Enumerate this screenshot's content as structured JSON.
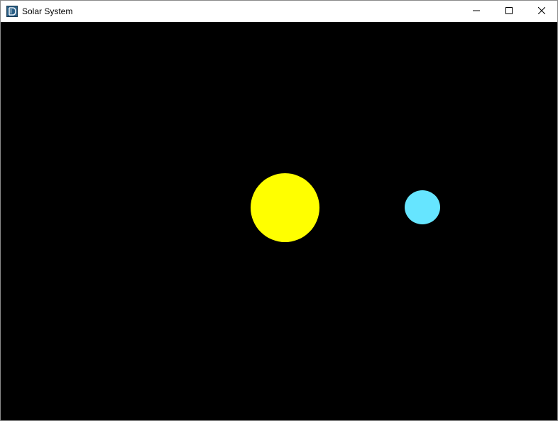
{
  "window": {
    "title": "Solar System",
    "app_icon": "app-logo-icon"
  },
  "caption_buttons": {
    "minimize_icon": "minimize-icon",
    "maximize_icon": "maximize-icon",
    "close_icon": "close-icon"
  },
  "scene": {
    "background_color": "#000000",
    "sun_color": "#ffff00",
    "planet_color": "#66e5ff"
  }
}
